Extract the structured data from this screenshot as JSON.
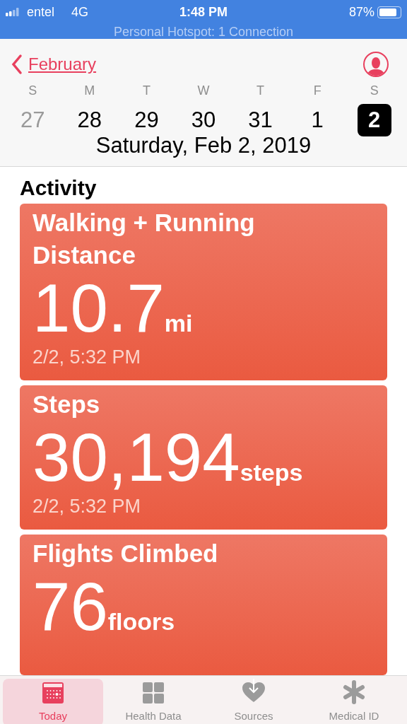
{
  "status_bar": {
    "carrier": "entel",
    "network": "4G",
    "time": "1:48 PM",
    "battery": "87%",
    "hotspot": "Personal Hotspot: 1 Connection"
  },
  "header": {
    "back": "February"
  },
  "week": [
    {
      "letter": "S",
      "date": "27",
      "selected": false,
      "muted": true
    },
    {
      "letter": "M",
      "date": "28",
      "selected": false,
      "muted": false
    },
    {
      "letter": "T",
      "date": "29",
      "selected": false,
      "muted": false
    },
    {
      "letter": "W",
      "date": "30",
      "selected": false,
      "muted": false
    },
    {
      "letter": "T",
      "date": "31",
      "selected": false,
      "muted": false
    },
    {
      "letter": "F",
      "date": "1",
      "selected": false,
      "muted": false
    },
    {
      "letter": "S",
      "date": "2",
      "selected": true,
      "muted": false
    }
  ],
  "full_date": "Saturday, Feb 2, 2019",
  "section": "Activity",
  "cards": [
    {
      "title": "Walking + Running Distance",
      "value": "10.7",
      "unit": "mi",
      "time": "2/2, 5:32 PM"
    },
    {
      "title": "Steps",
      "value": "30,194",
      "unit": "steps",
      "time": "2/2, 5:32 PM"
    },
    {
      "title": "Flights Climbed",
      "value": "76",
      "unit": "floors"
    }
  ],
  "tabs": [
    {
      "label": "Today",
      "selected": true
    },
    {
      "label": "Health Data",
      "selected": false
    },
    {
      "label": "Sources",
      "selected": false
    },
    {
      "label": "Medical ID",
      "selected": false
    }
  ]
}
